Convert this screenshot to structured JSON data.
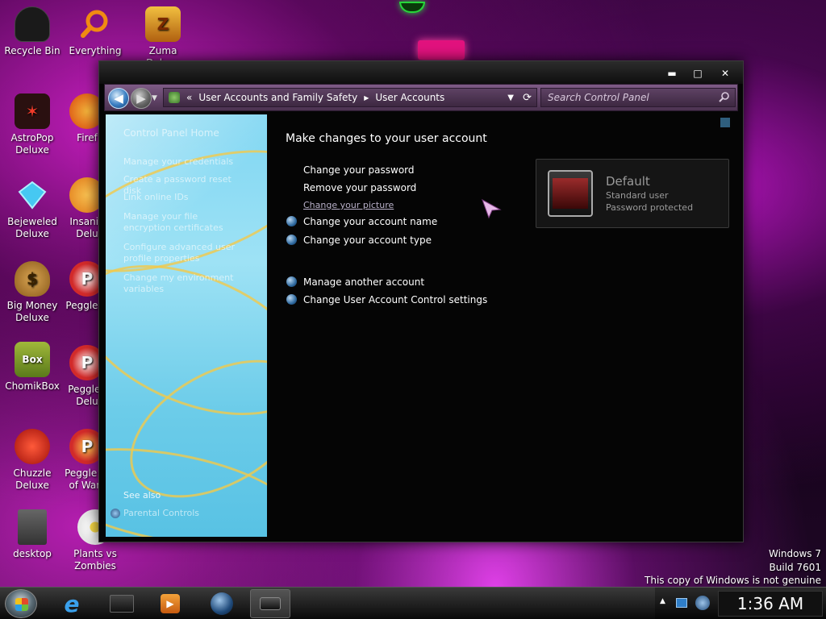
{
  "desktop": {
    "icons": [
      {
        "label": "Recycle Bin",
        "icon": "recycle-bin-icon",
        "color": "#1a1a1a"
      },
      {
        "label": "Everything",
        "icon": "magnifier-icon",
        "color": "#f08a12"
      },
      {
        "label": "Zuma Deluxe",
        "icon": "zuma-icon",
        "color": "#e0a020"
      },
      {
        "label": "AstroPop Deluxe",
        "icon": "astropop-icon",
        "color": "#e33322"
      },
      {
        "label": "Firef",
        "icon": "firefox-icon",
        "color": "#e96b14"
      },
      {
        "label": "Bejeweled Deluxe",
        "icon": "gem-icon",
        "color": "#3fc6f0"
      },
      {
        "label": "Insaniq Delu",
        "icon": "insaniquarium-icon",
        "color": "#f09820"
      },
      {
        "label": "Big Money Deluxe",
        "icon": "money-bag-icon",
        "color": "#b07b2a"
      },
      {
        "label": "Peggle D",
        "icon": "peggle-icon",
        "color": "#d22a2a"
      },
      {
        "label": "ChomikBox",
        "icon": "chomikbox-icon",
        "color": "#7a9a2a"
      },
      {
        "label": "Peggle I Delu",
        "icon": "peggle-nights-icon",
        "color": "#d22a2a"
      },
      {
        "label": "Chuzzle Deluxe",
        "icon": "chuzzle-icon",
        "color": "#d8201a"
      },
      {
        "label": "Peggle W of Warc",
        "icon": "peggle-wow-icon",
        "color": "#d22a2a"
      },
      {
        "label": "desktop",
        "icon": "file-icon",
        "color": "#888888"
      },
      {
        "label": "Plants vs Zombies",
        "icon": "flower-icon",
        "color": "#eaeaea"
      }
    ]
  },
  "window": {
    "controls": {
      "minimize": "▬",
      "maximize": "□",
      "close": "✕"
    },
    "breadcrumb": {
      "prefix": "«",
      "parent": "User Accounts and Family Safety",
      "separator": "▶",
      "current": "User Accounts"
    },
    "search": {
      "placeholder": "Search Control Panel"
    },
    "left_pane": {
      "home": "Control Panel Home",
      "links": [
        "Manage your credentials",
        "Create a password reset disk",
        "Link online IDs",
        "Manage your file encryption certificates",
        "Configure advanced user profile properties",
        "Change my environment variables"
      ],
      "see_also": "See also",
      "parental": "Parental Controls"
    },
    "content": {
      "title": "Make changes to your user account",
      "tasks_plain": [
        "Change your password",
        "Remove your password",
        "Change your picture"
      ],
      "tasks_icon": [
        "Change your account name",
        "Change your account type"
      ],
      "tasks_other": [
        "Manage another account",
        "Change User Account Control settings"
      ]
    },
    "account": {
      "name": "Default",
      "type": "Standard user",
      "status": "Password protected"
    }
  },
  "taskbar": {
    "clock": "1:36 AM"
  },
  "watermark": {
    "line1": "Windows 7",
    "line2": "Build 7601",
    "line3": "This copy of Windows is not genuine"
  }
}
